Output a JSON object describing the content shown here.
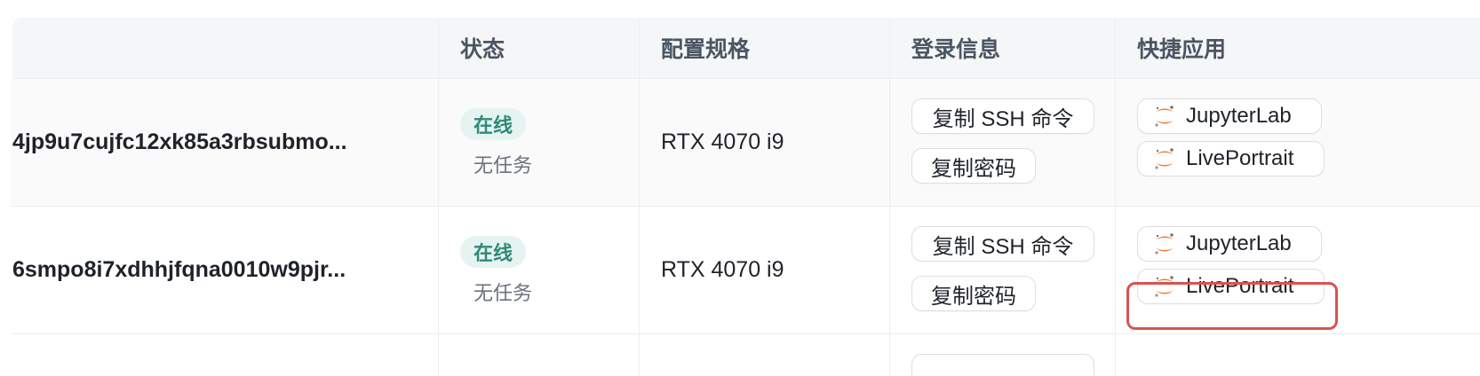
{
  "columns": {
    "status": "状态",
    "spec": "配置规格",
    "login": "登录信息",
    "apps": "快捷应用"
  },
  "rows": [
    {
      "name": "4jp9u7cujfc12xk85a3rbsubmo...",
      "status": "在线",
      "task": "无任务",
      "spec": "RTX 4070 i9",
      "login": {
        "ssh": "复制 SSH 命令",
        "password": "复制密码"
      },
      "apps": [
        {
          "label": "JupyterLab",
          "icon": "jupyter-icon"
        },
        {
          "label": "LivePortrait",
          "icon": "jupyter-icon"
        }
      ]
    },
    {
      "name": "6smpo8i7xdhhjfqna0010w9pjr...",
      "status": "在线",
      "task": "无任务",
      "spec": "RTX 4070 i9",
      "login": {
        "ssh": "复制 SSH 命令",
        "password": "复制密码"
      },
      "apps": [
        {
          "label": "JupyterLab",
          "icon": "jupyter-icon"
        },
        {
          "label": "LivePortrait",
          "icon": "jupyter-icon"
        }
      ]
    }
  ],
  "colors": {
    "online_bg": "#e6f4f1",
    "online_text": "#2f8a78",
    "highlight": "#d9534f",
    "jupyter_orange": "#f37726"
  }
}
